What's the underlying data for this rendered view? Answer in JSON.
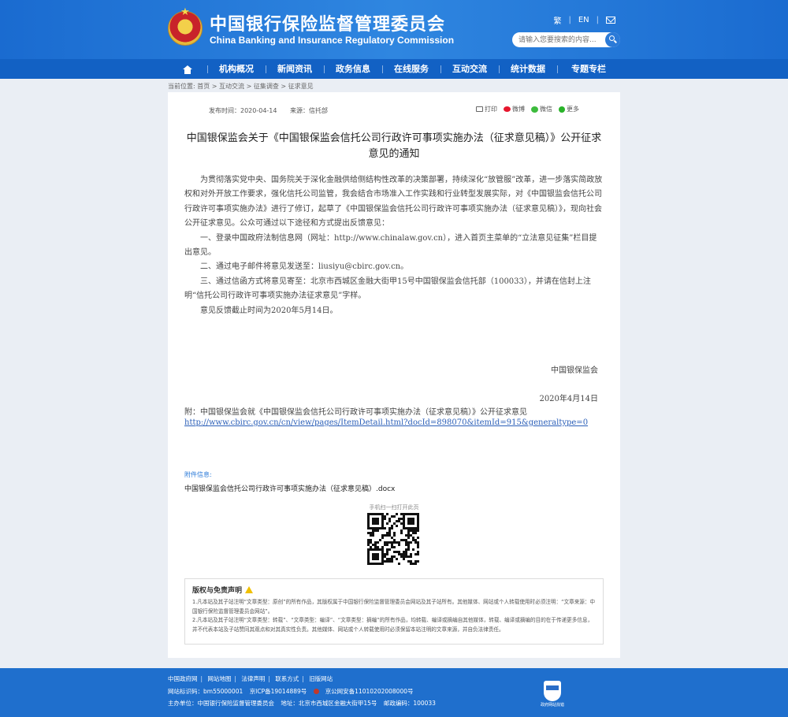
{
  "header": {
    "title_cn": "中国银行保险监督管理委员会",
    "title_en": "China Banking and Insurance Regulatory Commission",
    "traditional_link": "繁",
    "english_link": "EN",
    "search_placeholder": "请输入您要搜索的内容..."
  },
  "nav": {
    "items": [
      "机构概况",
      "新闻资讯",
      "政务信息",
      "在线服务",
      "互动交流",
      "统计数据",
      "专题专栏"
    ]
  },
  "breadcrumb": {
    "label": "当前位置:",
    "items": [
      "首页",
      "互动交流",
      "征集调查",
      "征求意见"
    ]
  },
  "article": {
    "publish_time": "发布时间：2020-04-14",
    "source": "来源：信托部",
    "share": {
      "print": "打印",
      "weibo": "微博",
      "wechat": "微信",
      "more": "更多"
    },
    "title": "中国银保监会关于《中国银保监会信托公司行政许可事项实施办法（征求意见稿）》公开征求意见的通知",
    "paragraphs": [
      "为贯彻落实党中央、国务院关于深化金融供给侧结构性改革的决策部署，持续深化“放管服”改革，进一步落实简政放权和对外开放工作要求，强化信托公司监管，我会结合市场准入工作实践和行业转型发展实际，对《中国银监会信托公司行政许可事项实施办法》进行了修订，起草了《中国银保监会信托公司行政许可事项实施办法（征求意见稿）》，现向社会公开征求意见。公众可通过以下途径和方式提出反馈意见：",
      "一、登录中国政府法制信息网（网址：http://www.chinalaw.gov.cn），进入首页主菜单的“立法意见征集”栏目提出意见。",
      "二、通过电子邮件将意见发送至：liusiyu@cbirc.gov.cn。",
      "三、通过信函方式将意见寄至：北京市西城区金融大街甲15号中国银保监会信托部（100033），并请在信封上注明“信托公司行政许可事项实施办法征求意见”字样。",
      "意见反馈截止时间为2020年5月14日。"
    ],
    "signature_org": "中国银保监会",
    "signature_date": "2020年4月14日",
    "appendix": "附：中国银保监会就《中国银保监会信托公司行政许可事项实施办法（征求意见稿）》公开征求意见",
    "appendix_link": "http://www.cbirc.gov.cn/cn/view/pages/ItemDetail.html?docId=898070&itemId=915&generaltype=0",
    "attachment_label": "附件信息:",
    "attachment_file": "中国银保监会信托公司行政许可事项实施办法（征求意见稿）.docx",
    "qr_caption": "手机扫一扫打开此页"
  },
  "notice": {
    "title": "版权与免责声明",
    "item1": "1.凡本站及其子站注明“文章类型：原创”的所有作品，其版权属于中国银行保险监督管理委员会网站及其子站所有。其他媒体、网站或个人转载使用时必须注明：“文章来源：中国银行保险监督管理委员会网站”。",
    "item2": "2.凡本站及其子站注明“文章类型：转载”、“文章类型：编译”、“文章类型：摘编”的所有作品，均转载、编译或摘编自其他媒体，转载、编译或摘编的目的在于传递更多信息，并不代表本站及子站赞同其观点和对其真实性负责。其他媒体、网站或个人转载使用时必须保留本站注明的文章来源，并自负法律责任。"
  },
  "footer": {
    "links": [
      "中国政府网",
      "网站地图",
      "法律声明",
      "联系方式",
      "旧版网站"
    ],
    "site_code": "网站标识码：bm55000001",
    "icp": "京ICP备19014889号",
    "police": "京公网安备11010202008000号",
    "host": "主办单位：中国银行保险监督管理委员会",
    "address": "地址：北京市西城区金融大街甲15号",
    "postcode": "邮政编码：100033",
    "badge_label": "政府网站找错"
  },
  "colors": {
    "header": "#1a6bd0",
    "nav": "#1261c4",
    "footer": "#1f6fcd",
    "link": "#2b5fb8"
  }
}
